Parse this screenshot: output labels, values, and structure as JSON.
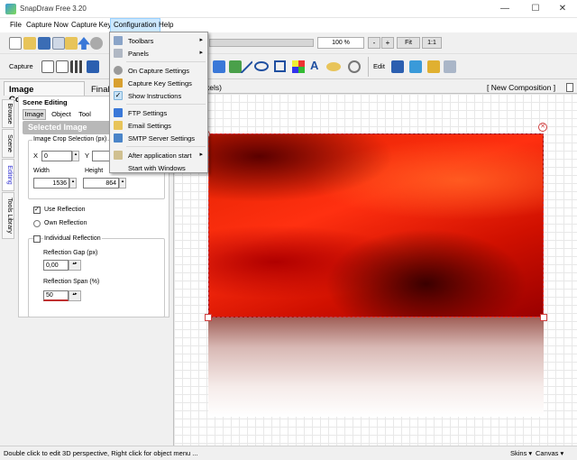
{
  "window": {
    "title": "SnapDraw Free 3.20"
  },
  "menubar": [
    "File",
    "Capture Now",
    "Capture Key",
    "Configuration",
    "Help"
  ],
  "toolbar1": {
    "zoom": "100 %",
    "minus": "-",
    "plus": "+",
    "fit": "Fit",
    "one": "1:1"
  },
  "toolbar2": {
    "capture": "Capture",
    "edit": "Edit"
  },
  "dropdown": {
    "items": [
      {
        "label": "Toolbars",
        "icon": "toolbars-icon",
        "arrow": "▸"
      },
      {
        "label": "Panels",
        "icon": "panels-icon",
        "arrow": "▸"
      },
      {
        "label": "On Capture Settings",
        "icon": "gear-icon"
      },
      {
        "label": "Capture Key Settings",
        "icon": "key-icon"
      },
      {
        "label": "Show Instructions",
        "icon": "checkmark-icon"
      },
      {
        "label": "FTP Settings",
        "icon": "ftp-icon"
      },
      {
        "label": "Email Settings",
        "icon": "email-icon"
      },
      {
        "label": "SMTP Server Settings",
        "icon": "server-icon"
      },
      {
        "label": "After application start",
        "icon": "application-icon",
        "arrow": "▸"
      },
      {
        "label": "Start with Windows",
        "icon": ""
      }
    ]
  },
  "panel": {
    "header_tab1": "Image Composition",
    "header_tab2": "Final",
    "scene_editing": "Scene Editing",
    "tabs": [
      "Image",
      "Object",
      "Tool"
    ],
    "selected_header": "Selected Image",
    "crop_group": "Image Crop Selection (px)",
    "x_label": "X",
    "x_value": "0",
    "y_label": "Y",
    "width_label": "Width",
    "width_value": "1536",
    "height_label": "Height",
    "height_value": "864",
    "use_reflection": "Use Reflection",
    "own_reflection": "Own Reflection",
    "individual_reflection": "Individual Reflection",
    "gap_label": "Reflection Gap (px)",
    "gap_value": "0,00",
    "span_label": "Reflection Span (%)",
    "span_value": "50"
  },
  "vtabs": [
    "Browse",
    "Scene",
    "Editing",
    "Tools Library"
  ],
  "canvas": {
    "header_left": "xels)",
    "header_right": "[ New Composition ]"
  },
  "status": {
    "left": "Double click to edit 3D perspective, Right click for object menu ...",
    "skins": "Skins ▾",
    "canvas": "Canvas ▾"
  }
}
